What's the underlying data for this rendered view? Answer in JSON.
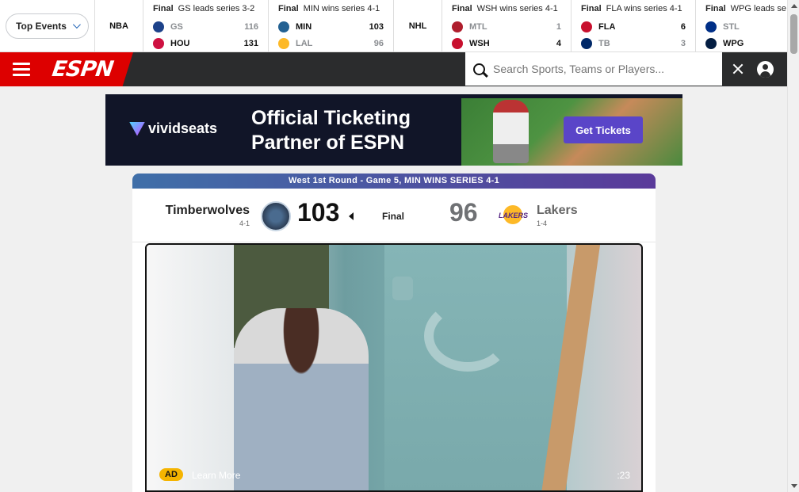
{
  "top_events": {
    "label": "Top Events"
  },
  "leagues": {
    "nba": "NBA",
    "nhl": "NHL"
  },
  "games": [
    {
      "status": "Final",
      "note": "GS leads series 3-2",
      "teams": [
        {
          "abbr": "GS",
          "score": "116",
          "color": "#1d428a"
        },
        {
          "abbr": "HOU",
          "score": "131",
          "color": "#ce1141"
        }
      ]
    },
    {
      "status": "Final",
      "note": "MIN wins series 4-1",
      "teams": [
        {
          "abbr": "MIN",
          "score": "103",
          "color": "#236192"
        },
        {
          "abbr": "LAL",
          "score": "96",
          "color": "#fdb927"
        }
      ]
    },
    {
      "status": "Final",
      "note": "WSH wins series 4-1",
      "teams": [
        {
          "abbr": "MTL",
          "score": "1",
          "color": "#af1e2d"
        },
        {
          "abbr": "WSH",
          "score": "4",
          "color": "#c8102e"
        }
      ]
    },
    {
      "status": "Final",
      "note": "FLA wins series 4-1",
      "teams": [
        {
          "abbr": "FLA",
          "score": "6",
          "color": "#c8102e"
        },
        {
          "abbr": "TB",
          "score": "3",
          "color": "#002868"
        }
      ]
    },
    {
      "status": "Final",
      "note": "WPG leads se",
      "teams": [
        {
          "abbr": "STL",
          "score": "",
          "color": "#002f87"
        },
        {
          "abbr": "WPG",
          "score": "",
          "color": "#041e42"
        }
      ]
    }
  ],
  "nav": {
    "brand": "ESPN",
    "search_placeholder": "Search Sports, Teams or Players..."
  },
  "ad": {
    "sponsor": "vividseats",
    "headline_line1": "Official Ticketing",
    "headline_line2": "Partner of ESPN",
    "cta": "Get Tickets"
  },
  "game_card": {
    "banner": "West 1st Round - Game 5, MIN WINS SERIES 4-1",
    "home": {
      "name": "Timberwolves",
      "record": "4-1",
      "score": "103"
    },
    "status": "Final",
    "away": {
      "name": "Lakers",
      "record": "1-4",
      "score": "96",
      "logo_text": "LAKERS"
    }
  },
  "video": {
    "ad_label": "AD",
    "learn_more": "Learn More",
    "duration": ":23"
  }
}
